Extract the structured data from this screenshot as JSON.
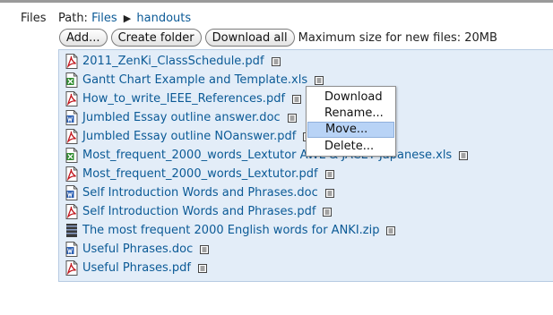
{
  "files_label": "Files",
  "path": {
    "label": "Path:",
    "crumbs": [
      "Files",
      "handouts"
    ],
    "separator": "▶"
  },
  "toolbar": {
    "add": "Add...",
    "create_folder": "Create folder",
    "download_all": "Download all",
    "max_size": "Maximum size for new files: 20MB"
  },
  "files": [
    {
      "name": "2011_ZenKi_ClassSchedule.pdf",
      "type": "pdf"
    },
    {
      "name": "Gantt Chart Example and Template.xls",
      "type": "xls"
    },
    {
      "name": "How_to_write_IEEE_References.pdf",
      "type": "pdf"
    },
    {
      "name": "Jumbled Essay outline answer.doc",
      "type": "doc"
    },
    {
      "name": "Jumbled Essay outline NOanswer.pdf",
      "type": "pdf"
    },
    {
      "name": "Most_frequent_2000_words_Lextutor AWL & JACET Japanese.xls",
      "type": "xls"
    },
    {
      "name": "Most_frequent_2000_words_Lextutor.pdf",
      "type": "pdf"
    },
    {
      "name": "Self Introduction Words and Phrases.doc",
      "type": "doc"
    },
    {
      "name": "Self Introduction Words and Phrases.pdf",
      "type": "pdf"
    },
    {
      "name": "The most frequent 2000 English words for ANKI.zip",
      "type": "zip"
    },
    {
      "name": "Useful Phrases.doc",
      "type": "doc"
    },
    {
      "name": "Useful Phrases.pdf",
      "type": "pdf"
    }
  ],
  "context_menu": {
    "items": [
      "Download",
      "Rename...",
      "Move...",
      "Delete..."
    ],
    "highlighted": "Move..."
  },
  "icons": {
    "file_pdf": "pdf-file-icon",
    "file_xls": "excel-file-icon",
    "file_doc": "word-file-icon",
    "file_zip": "zip-archive-icon",
    "menu": "file-menu-icon"
  },
  "colors": {
    "link": "#0b5a96",
    "panel_bg": "#e3edf8",
    "menu_highlight": "#b8d3f6"
  }
}
